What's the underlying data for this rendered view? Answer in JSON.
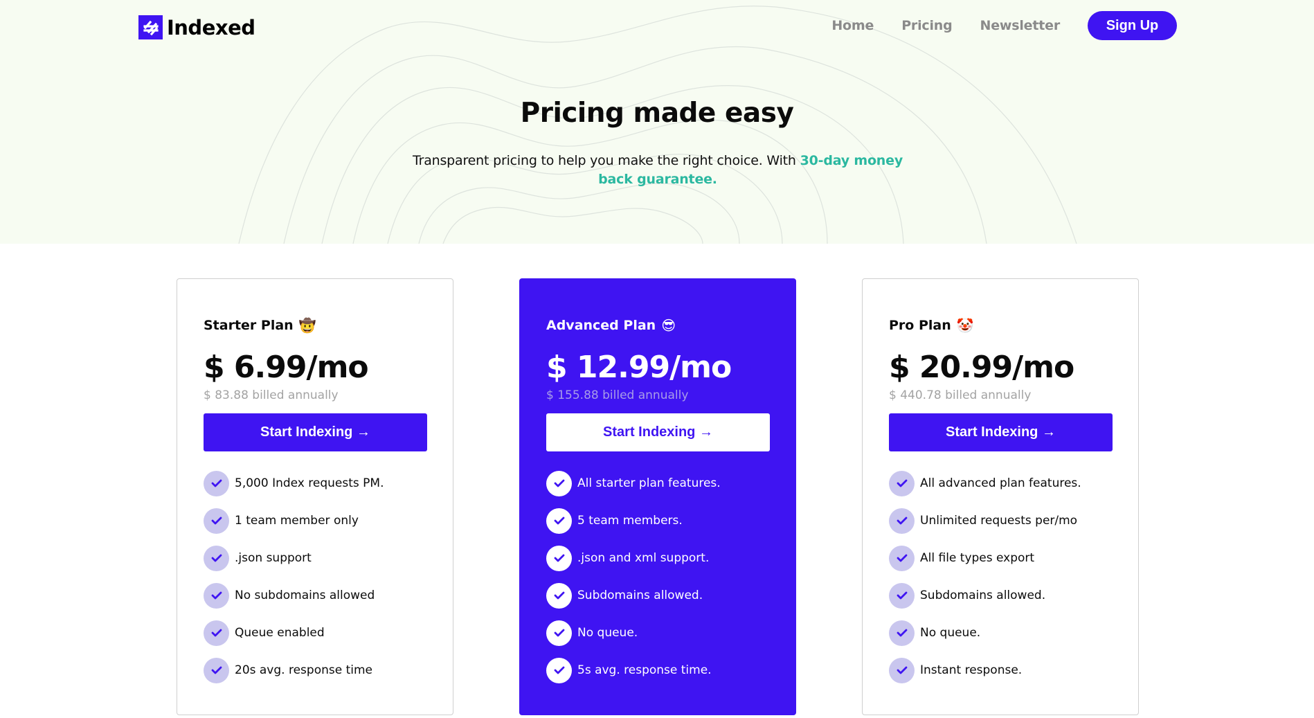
{
  "brand": {
    "name": "Indexed",
    "accent_color": "#3f14f2",
    "highlight_color": "#2bb8a0",
    "logo_icon": "hash-lines-icon"
  },
  "nav": {
    "links": [
      "Home",
      "Pricing",
      "Newsletter"
    ],
    "signup_label": "Sign Up"
  },
  "hero": {
    "title": "Pricing made easy",
    "subtitle_text": "Transparent pricing to help you make the right choice. With ",
    "subtitle_highlight": "30-day money back guarantee."
  },
  "plans": [
    {
      "name": "Starter Plan",
      "emoji": "🤠",
      "price": "$ 6.99/mo",
      "billed": "$ 83.88 billed annually",
      "cta": "Start Indexing →",
      "featured": false,
      "features": [
        "5,000 Index requests PM.",
        "1 team member only",
        ".json support",
        "No subdomains allowed",
        "Queue enabled",
        "20s avg. response time"
      ]
    },
    {
      "name": "Advanced Plan",
      "emoji": "😎",
      "price": "$ 12.99/mo",
      "billed": "$ 155.88 billed annually",
      "cta": "Start Indexing →",
      "featured": true,
      "features": [
        "All starter plan features.",
        "5 team members.",
        ".json and xml support.",
        "Subdomains allowed.",
        "No queue.",
        "5s avg. response time."
      ]
    },
    {
      "name": "Pro Plan",
      "emoji": "🤡",
      "price": "$ 20.99/mo",
      "billed": "$ 440.78 billed annually",
      "cta": "Start Indexing →",
      "featured": false,
      "features": [
        "All advanced plan features.",
        "Unlimited requests per/mo",
        "All file types export",
        "Subdomains allowed.",
        "No queue.",
        "Instant response."
      ]
    }
  ]
}
